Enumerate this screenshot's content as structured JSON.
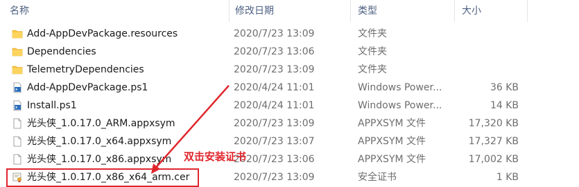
{
  "columns": {
    "name": "名称",
    "date": "修改日期",
    "type": "类型",
    "size": "大小"
  },
  "files": [
    {
      "name": "Add-AppDevPackage.resources",
      "date": "2020/7/23 13:09",
      "type": "文件夹",
      "size": "",
      "icon": "folder-icon"
    },
    {
      "name": "Dependencies",
      "date": "2020/7/23 13:06",
      "type": "文件夹",
      "size": "",
      "icon": "folder-icon"
    },
    {
      "name": "TelemetryDependencies",
      "date": "2020/7/23 13:09",
      "type": "文件夹",
      "size": "",
      "icon": "folder-icon"
    },
    {
      "name": "Add-AppDevPackage.ps1",
      "date": "2020/4/24 11:01",
      "type": "Windows Power...",
      "size": "36 KB",
      "icon": "powershell-script-icon"
    },
    {
      "name": "Install.ps1",
      "date": "2020/4/24 11:01",
      "type": "Windows Power...",
      "size": "14 KB",
      "icon": "powershell-script-icon"
    },
    {
      "name": "光头侠_1.0.17.0_ARM.appxsym",
      "date": "2020/7/23 13:09",
      "type": "APPXSYM 文件",
      "size": "17,320 KB",
      "icon": "file-icon"
    },
    {
      "name": "光头侠_1.0.17.0_x64.appxsym",
      "date": "2020/7/23 13:07",
      "type": "APPXSYM 文件",
      "size": "17,327 KB",
      "icon": "file-icon"
    },
    {
      "name": "光头侠_1.0.17.0_x86.appxsym",
      "date": "2020/7/23 13:06",
      "type": "APPXSYM 文件",
      "size": "17,002 KB",
      "icon": "file-icon"
    },
    {
      "name": "光头侠_1.0.17.0_x86_x64_arm.cer",
      "date": "2020/7/23 13:09",
      "type": "安全证书",
      "size": "1 KB",
      "icon": "certificate-icon"
    }
  ],
  "annotation": {
    "text": "双击安装证书",
    "color": "#e0252c"
  },
  "colors": {
    "folder": "#f8c443",
    "header_text": "#4d6082",
    "annotation": "#e0252c"
  }
}
